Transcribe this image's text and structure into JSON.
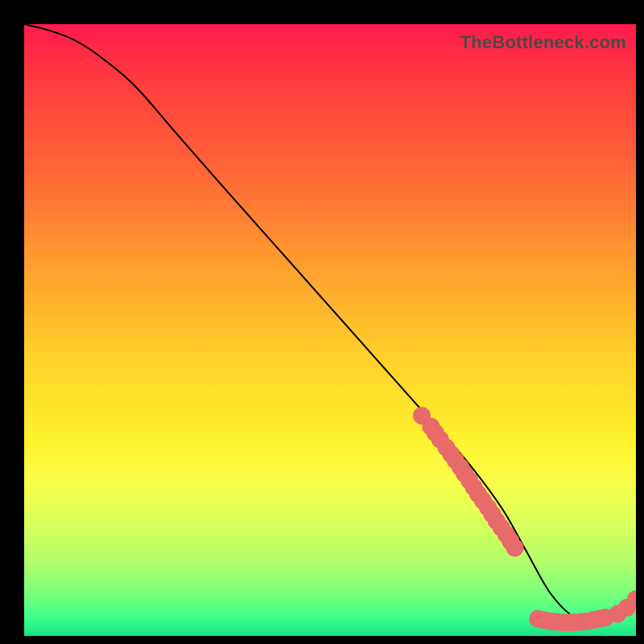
{
  "attribution": "TheBottleneck.com",
  "chart_data": {
    "type": "line",
    "title": "",
    "xlabel": "",
    "ylabel": "",
    "xlim": [
      0,
      100
    ],
    "ylim": [
      0,
      100
    ],
    "grid": false,
    "legend": false,
    "series": [
      {
        "name": "bottleneck-curve",
        "x": [
          0,
          4,
          8,
          12,
          18,
          25,
          32,
          40,
          48,
          56,
          64,
          72,
          78,
          82,
          86,
          90,
          94,
          97,
          100
        ],
        "y": [
          100,
          99,
          97.5,
          95,
          90,
          82,
          74,
          65,
          56,
          47,
          38,
          29,
          21,
          14,
          7,
          3,
          2,
          3,
          6
        ]
      }
    ],
    "markers": [
      {
        "name": "highlight-cluster-steep",
        "x": [
          65,
          66.5,
          67.2,
          68,
          69,
          69.8,
          70.5,
          71.3,
          72,
          72.8,
          73.5,
          74.2,
          75,
          75.8,
          76.5,
          77.2,
          78,
          78.8,
          79.5,
          80.2
        ],
        "y": [
          36,
          34.2,
          33.2,
          32.1,
          30.8,
          29.7,
          28.7,
          27.6,
          26.5,
          25.4,
          24.3,
          23.2,
          22.1,
          21,
          19.9,
          18.8,
          17.7,
          16.6,
          15.5,
          14.4
        ]
      },
      {
        "name": "highlight-cluster-floor",
        "x": [
          84,
          85,
          86,
          87,
          88,
          89,
          90,
          91,
          92,
          93,
          94,
          95,
          97,
          98.5,
          100
        ],
        "y": [
          2.8,
          2.6,
          2.4,
          2.3,
          2.2,
          2.2,
          2.2,
          2.3,
          2.4,
          2.6,
          2.8,
          3.0,
          3.6,
          4.6,
          6.0
        ]
      }
    ]
  }
}
